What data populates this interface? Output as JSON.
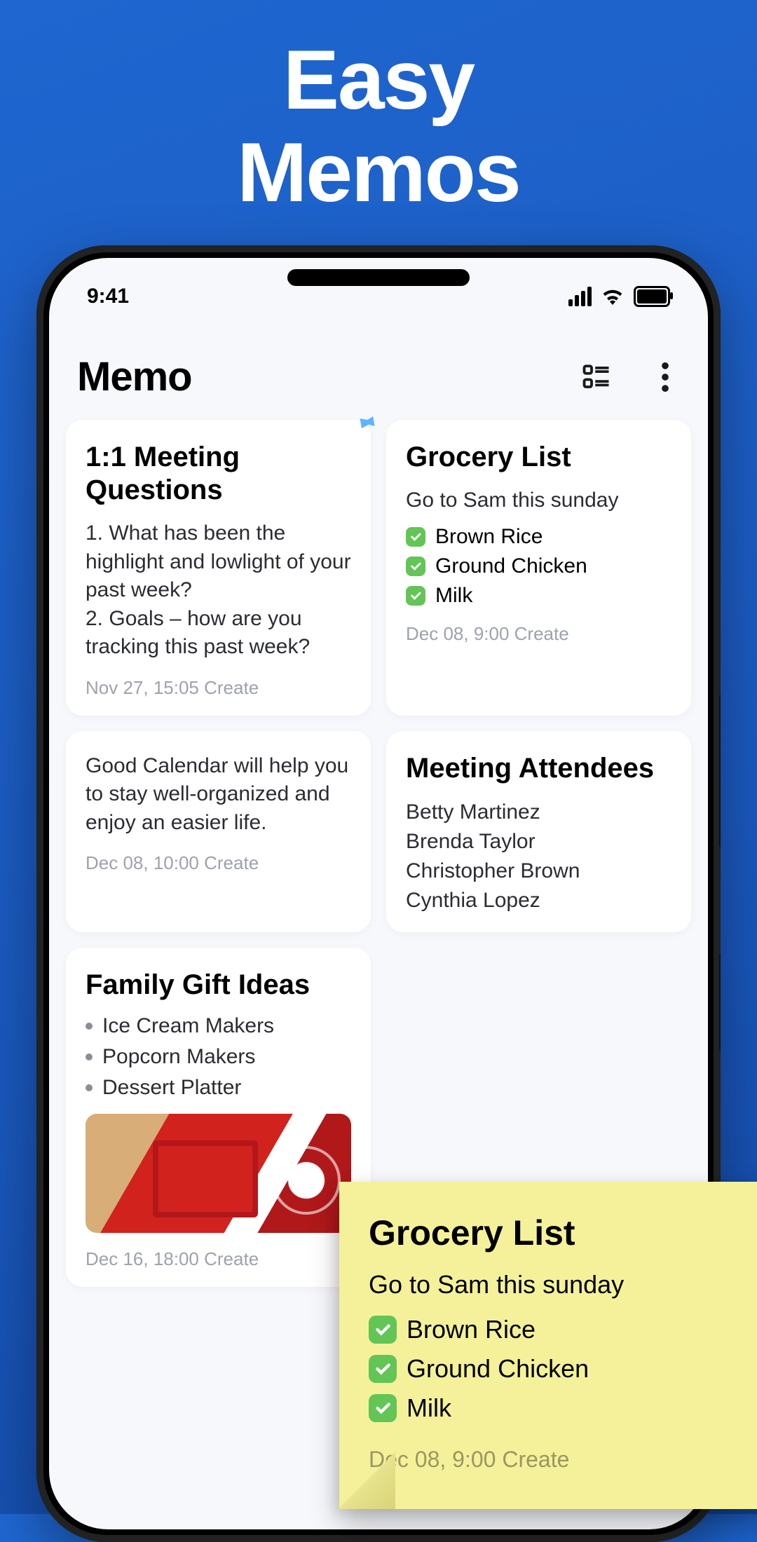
{
  "promo": {
    "line1": "Easy",
    "line2": "Memos"
  },
  "status": {
    "time": "9:41"
  },
  "app": {
    "title": "Memo"
  },
  "cards": {
    "meeting": {
      "title": "1:1 Meeting Questions",
      "body": "1. What has been the highlight and lowlight of your past week?\n2. Goals – how are you tracking this past week?",
      "meta": "Nov 27, 15:05 Create"
    },
    "grocery": {
      "title": "Grocery List",
      "sub": "Go to Sam this sunday",
      "items": [
        "Brown Rice",
        "Ground Chicken",
        "Milk"
      ],
      "meta": "Dec 08, 9:00 Create"
    },
    "promo": {
      "body": "Good Calendar will help you to stay well-organized and enjoy an easier life.",
      "meta": "Dec 08, 10:00 Create"
    },
    "attendees": {
      "title": "Meeting Attendees",
      "list": [
        "Betty Martinez",
        "Brenda Taylor",
        "Christopher Brown",
        "Cynthia Lopez"
      ]
    },
    "gifts": {
      "title": "Family Gift Ideas",
      "items": [
        "Ice Cream Makers",
        "Popcorn Makers",
        "Dessert Platter"
      ],
      "meta": "Dec 16, 18:00 Create"
    }
  },
  "sticky": {
    "title": "Grocery List",
    "sub": "Go to Sam this sunday",
    "items": [
      "Brown Rice",
      "Ground Chicken",
      "Milk"
    ],
    "meta": "Dec 08, 9:00 Create"
  }
}
